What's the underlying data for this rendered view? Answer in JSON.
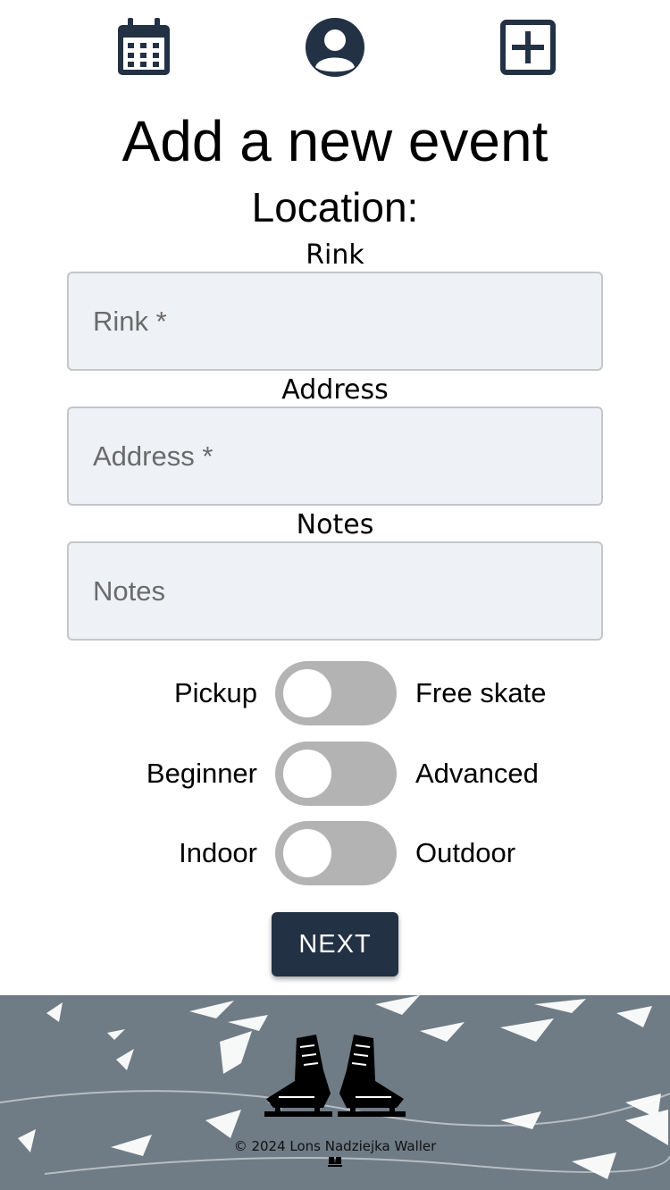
{
  "nav": {
    "items": [
      {
        "icon": "calendar-icon"
      },
      {
        "icon": "user-icon"
      },
      {
        "icon": "add-square-icon"
      }
    ]
  },
  "page": {
    "title": "Add a new event",
    "section_title": "Location:"
  },
  "form": {
    "rink": {
      "label": "Rink",
      "placeholder": "Rink *",
      "value": ""
    },
    "address": {
      "label": "Address",
      "placeholder": "Address *",
      "value": ""
    },
    "notes": {
      "label": "Notes",
      "placeholder": "Notes",
      "value": ""
    }
  },
  "toggles": [
    {
      "left": "Pickup",
      "right": "Free skate",
      "on": false
    },
    {
      "left": "Beginner",
      "right": "Advanced",
      "on": false
    },
    {
      "left": "Indoor",
      "right": "Outdoor",
      "on": false
    }
  ],
  "buttons": {
    "next": "NEXT"
  },
  "footer": {
    "logo_icon": "hockey-skates-icon",
    "copyright": "© 2024 Lons Nadziejka Waller"
  },
  "colors": {
    "primary": "#233145",
    "input_bg": "#eef1f6",
    "toggle_off": "#b3b3b3"
  }
}
